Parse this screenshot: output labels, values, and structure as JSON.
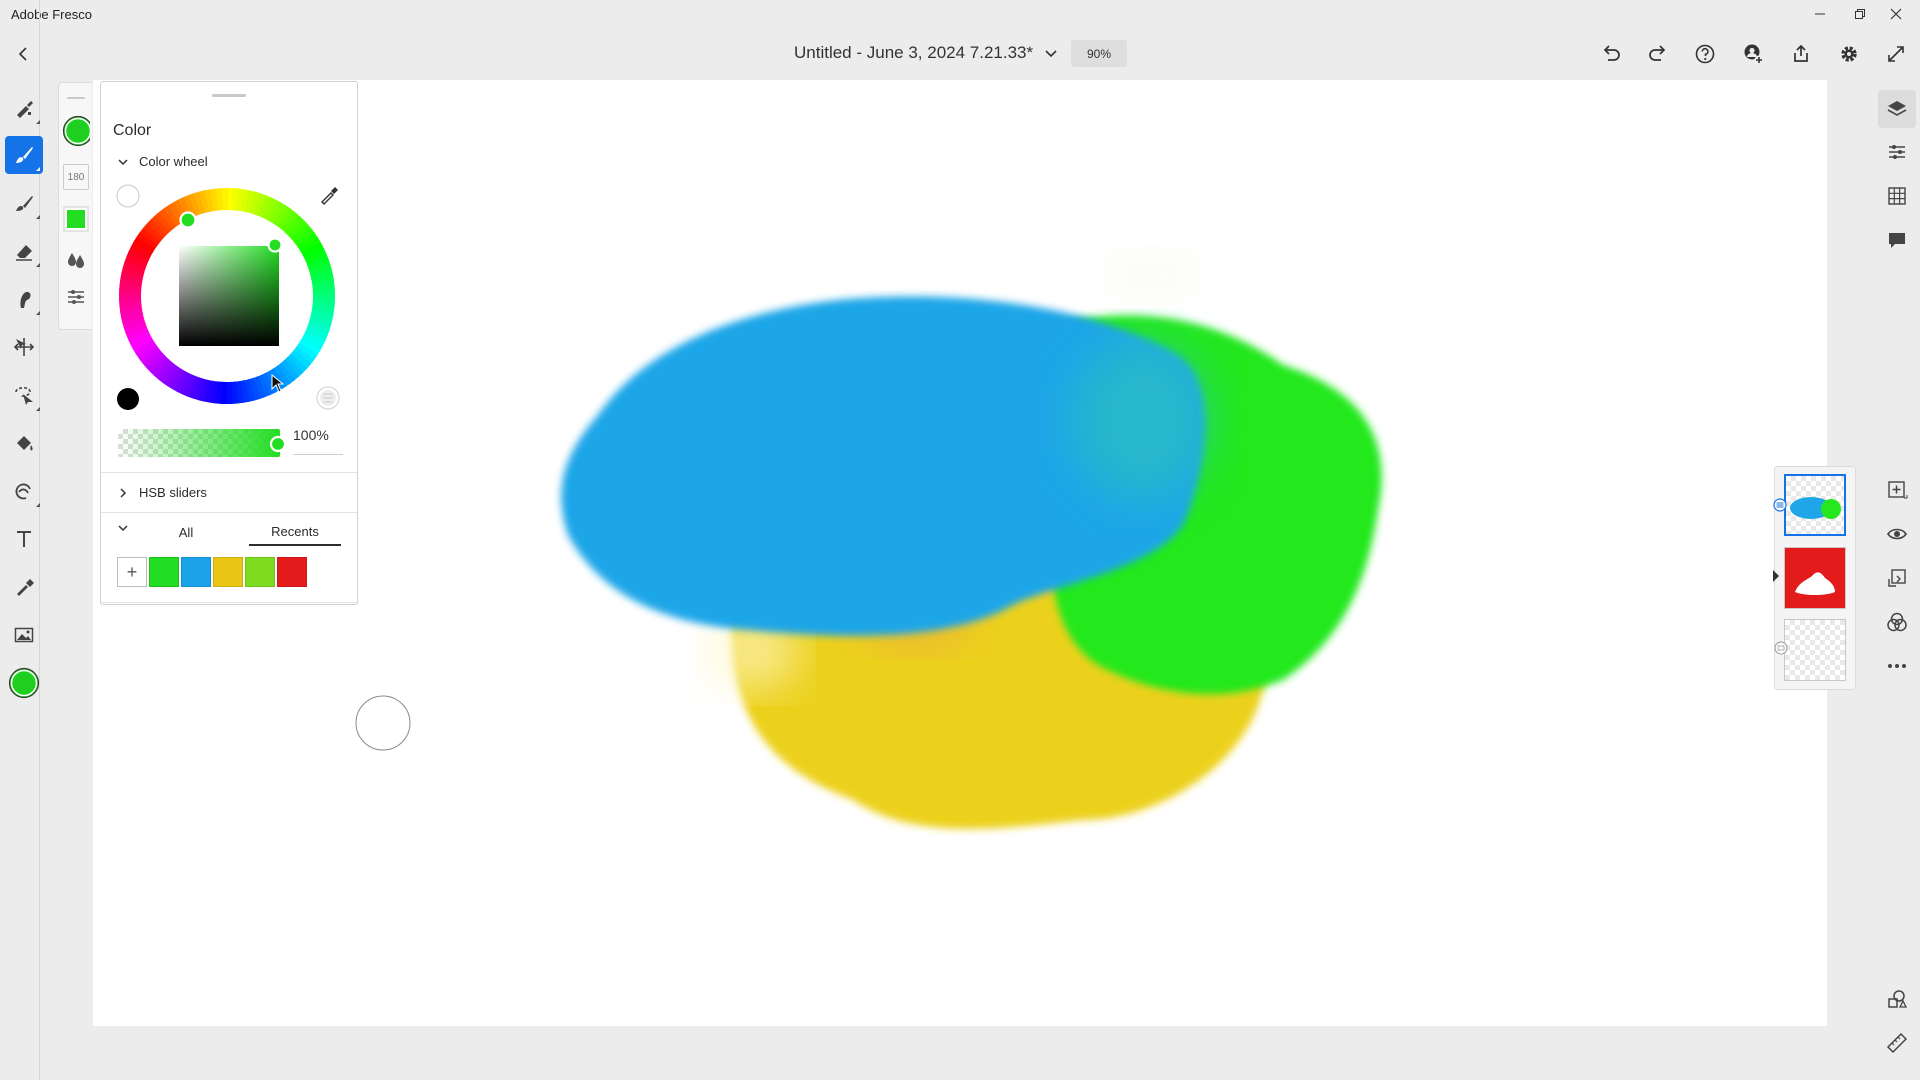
{
  "app": {
    "title": "Adobe Fresco"
  },
  "header": {
    "document_title": "Untitled - June 3, 2024 7.21.33*",
    "zoom": "90%"
  },
  "color_panel": {
    "title": "Color",
    "color_wheel_label": "Color wheel",
    "current_color": "#22dd22",
    "opacity_value": "100%",
    "hsb_label": "HSB sliders",
    "tabs": {
      "all": "All",
      "recents": "Recents"
    },
    "active_tab": "Recents",
    "recent_swatches": [
      "#22dd22",
      "#1aa3e8",
      "#e9c613",
      "#7ddc1f",
      "#e31b1b"
    ]
  },
  "subrail": {
    "size_value": "180"
  },
  "toolbar": {
    "tools": [
      "pixel-brush",
      "live-brush",
      "vector-brush",
      "eraser",
      "smudge",
      "move-transform",
      "selection",
      "fill",
      "liquify",
      "type",
      "eyedropper",
      "image",
      "color"
    ],
    "active_tool": "live-brush"
  },
  "layers": {
    "count": 3,
    "selected_index": 0
  },
  "colors": {
    "accent": "#1473e6",
    "canvas": "#ffffff",
    "chrome": "#ececec"
  }
}
